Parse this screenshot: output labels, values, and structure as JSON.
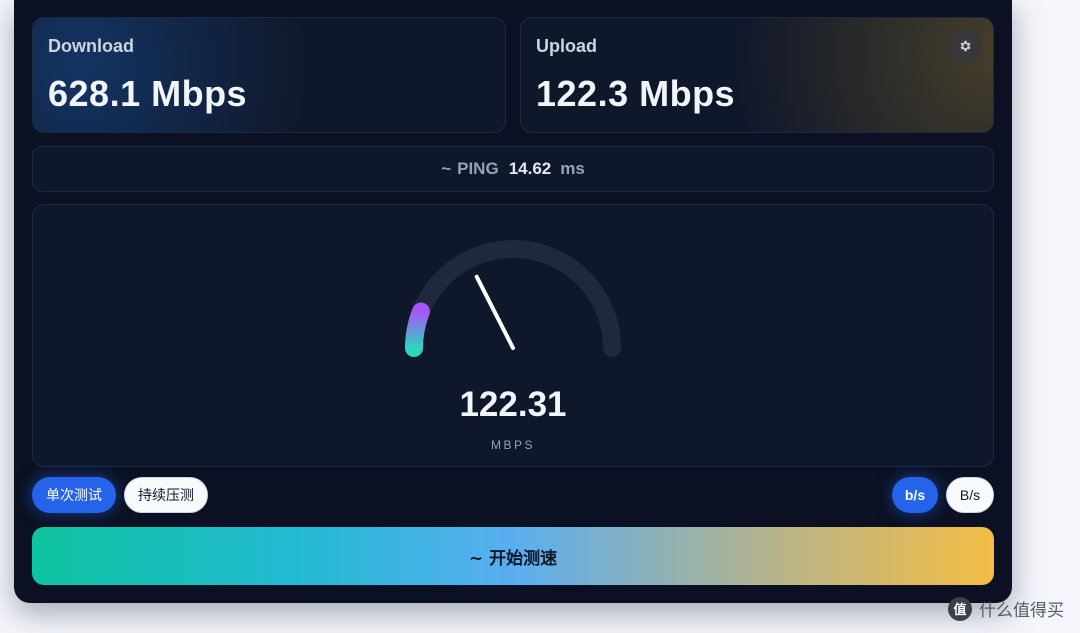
{
  "download": {
    "label": "Download",
    "value": "628.1 Mbps"
  },
  "upload": {
    "label": "Upload",
    "value": "122.3 Mbps",
    "settings_icon": "gear-icon"
  },
  "ping": {
    "prefix": "~",
    "label": "PING",
    "value": "14.62",
    "unit": "ms"
  },
  "gauge": {
    "value": "122.31",
    "unit": "MBPS",
    "fill_fraction": 0.12,
    "needle_fraction": 0.35,
    "fill_colors": [
      "#2dd4bf",
      "#a855f7"
    ]
  },
  "mode": {
    "single": "单次测试",
    "stress": "持续压测",
    "active": "single"
  },
  "units": {
    "bits": "b/s",
    "bytes": "B/s",
    "active": "bits"
  },
  "start_button": {
    "label": "~ 开始测速"
  },
  "watermark": {
    "logo_text": "值",
    "text": "什么值得买"
  },
  "colors": {
    "accent": "#2563eb",
    "background": "#0b1122",
    "panel": "#0f172a"
  }
}
